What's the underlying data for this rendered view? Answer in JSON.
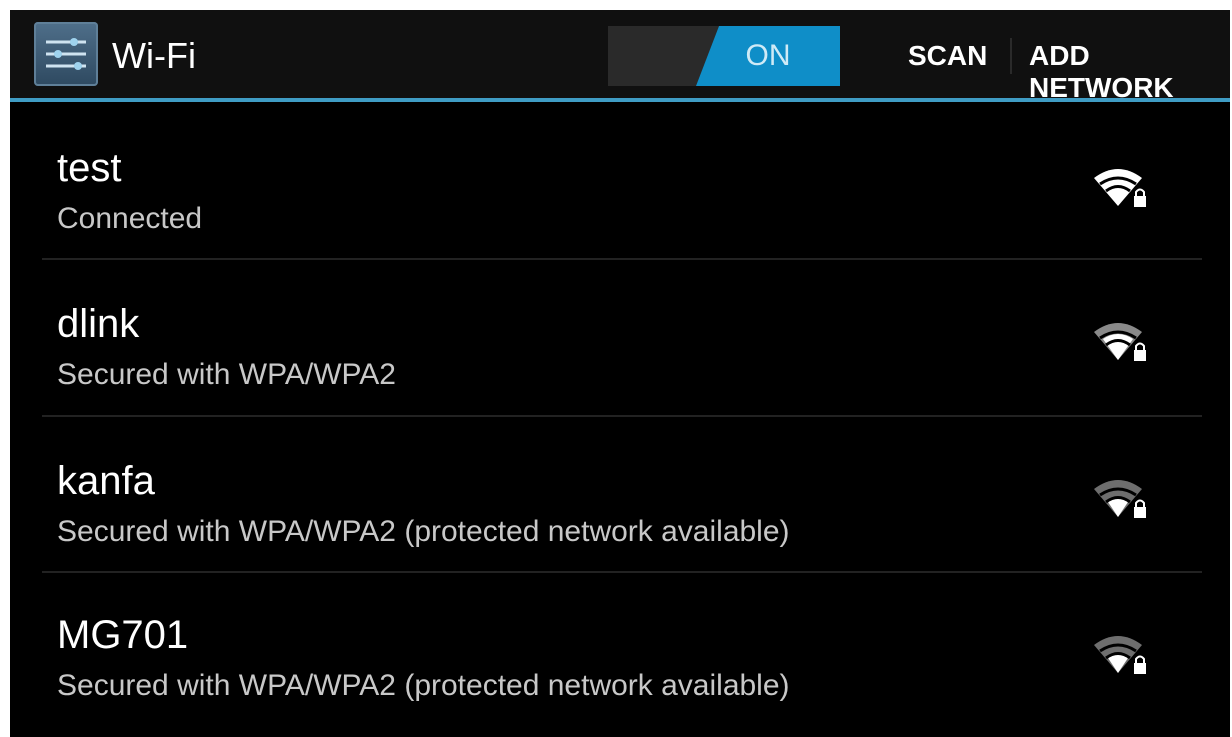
{
  "action_bar": {
    "title": "Wi-Fi",
    "app_icon": "settings-sliders-icon",
    "toggle_label": "ON",
    "scan_label": "SCAN",
    "add_network_label": "ADD NETWORK",
    "accent_color": "#3f9cc4",
    "toggle_color": "#0f8ec8"
  },
  "networks": [
    {
      "name": "test",
      "status": "Connected",
      "icon": "wifi-locked-icon",
      "signal": "strong"
    },
    {
      "name": "dlink",
      "status": "Secured with WPA/WPA2",
      "icon": "wifi-locked-icon",
      "signal": "strong"
    },
    {
      "name": "kanfa",
      "status": "Secured with WPA/WPA2 (protected network available)",
      "icon": "wifi-locked-icon",
      "signal": "medium"
    },
    {
      "name": "MG701",
      "status": "Secured with WPA/WPA2 (protected network available)",
      "icon": "wifi-locked-icon",
      "signal": "medium"
    }
  ]
}
